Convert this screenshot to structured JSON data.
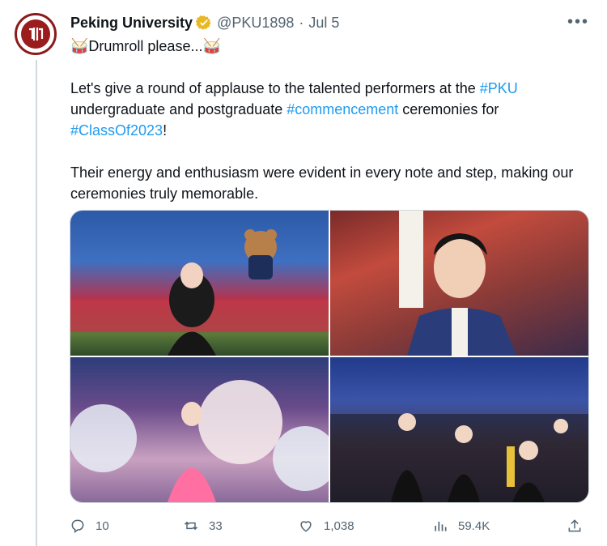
{
  "author": {
    "name": "Peking University",
    "handle": "@PKU1898",
    "separator": "·",
    "date": "Jul 5",
    "more": "•••"
  },
  "tweet": {
    "line1_prefix": "🥁Drumroll please...🥁",
    "line2a": "Let's give a round of applause to the talented performers at the ",
    "tag_pku": "#PKU",
    "line2b": "undergraduate and postgraduate ",
    "tag_commencement": "#commencement",
    "line2c": " ceremonies for",
    "tag_class": "#ClassOf2023",
    "line2d": "!",
    "line3": "Their energy and enthusiasm were evident in every note and step, making our ceremonies truly memorable."
  },
  "actions": {
    "reply_count": "10",
    "retweet_count": "33",
    "like_count": "1,038",
    "views_count": "59.4K"
  },
  "colors": {
    "link": "#1d9bf0",
    "muted": "#536471",
    "verified": "#e8b923",
    "brand": "#9b1c1c"
  }
}
